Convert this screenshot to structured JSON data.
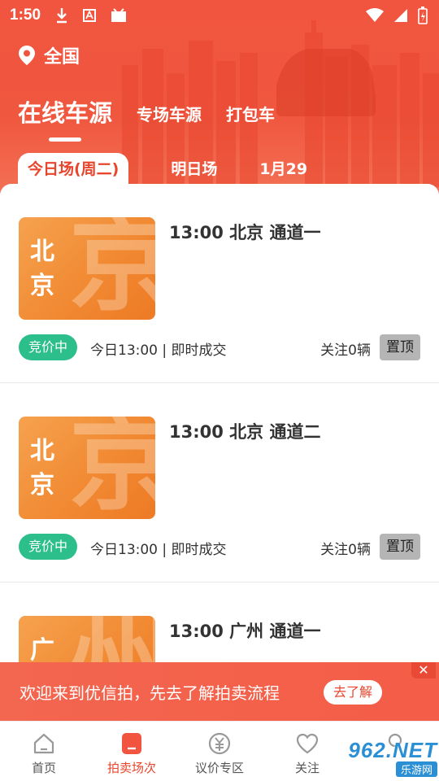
{
  "status_bar": {
    "time": "1:50"
  },
  "location": {
    "label": "全国"
  },
  "main_tabs": [
    {
      "label": "在线车源",
      "active": true
    },
    {
      "label": "专场车源",
      "active": false
    },
    {
      "label": "打包车",
      "active": false
    }
  ],
  "sub_tabs": [
    {
      "label": "今日场(周二)",
      "active": true
    },
    {
      "label": "明日场",
      "active": false
    },
    {
      "label": "1月29",
      "active": false
    }
  ],
  "cards": [
    {
      "thumb_city": "北京",
      "thumb_big": "京",
      "title": "13:00 北京 通道一",
      "badge": "竞价中",
      "time_info": "今日13:00 | 即时成交",
      "follow": "关注0辆",
      "pin": "置顶"
    },
    {
      "thumb_city": "北京",
      "thumb_big": "京",
      "title": "13:00 北京 通道二",
      "badge": "竞价中",
      "time_info": "今日13:00 | 即时成交",
      "follow": "关注0辆",
      "pin": "置顶"
    },
    {
      "thumb_city": "广州",
      "thumb_big": "州",
      "title": "13:00 广州 通道一",
      "badge": "",
      "time_info": "",
      "follow": "",
      "pin": ""
    }
  ],
  "banner": {
    "text": "欢迎来到优信拍，先去了解拍卖流程",
    "button": "去了解",
    "close": "✕"
  },
  "bottom_nav": [
    {
      "label": "首页",
      "icon": "home-icon",
      "active": false
    },
    {
      "label": "拍卖场次",
      "icon": "auction-icon",
      "active": true
    },
    {
      "label": "议价专区",
      "icon": "yuan-icon",
      "active": false
    },
    {
      "label": "关注",
      "icon": "heart-icon",
      "active": false
    },
    {
      "label": "",
      "icon": "user-icon",
      "active": false
    }
  ],
  "watermark": {
    "top": "962.NET",
    "bottom": "乐游网"
  },
  "colors": {
    "brand": "#f1553f",
    "badge": "#2cbf8c",
    "active_nav": "#e8452c"
  }
}
